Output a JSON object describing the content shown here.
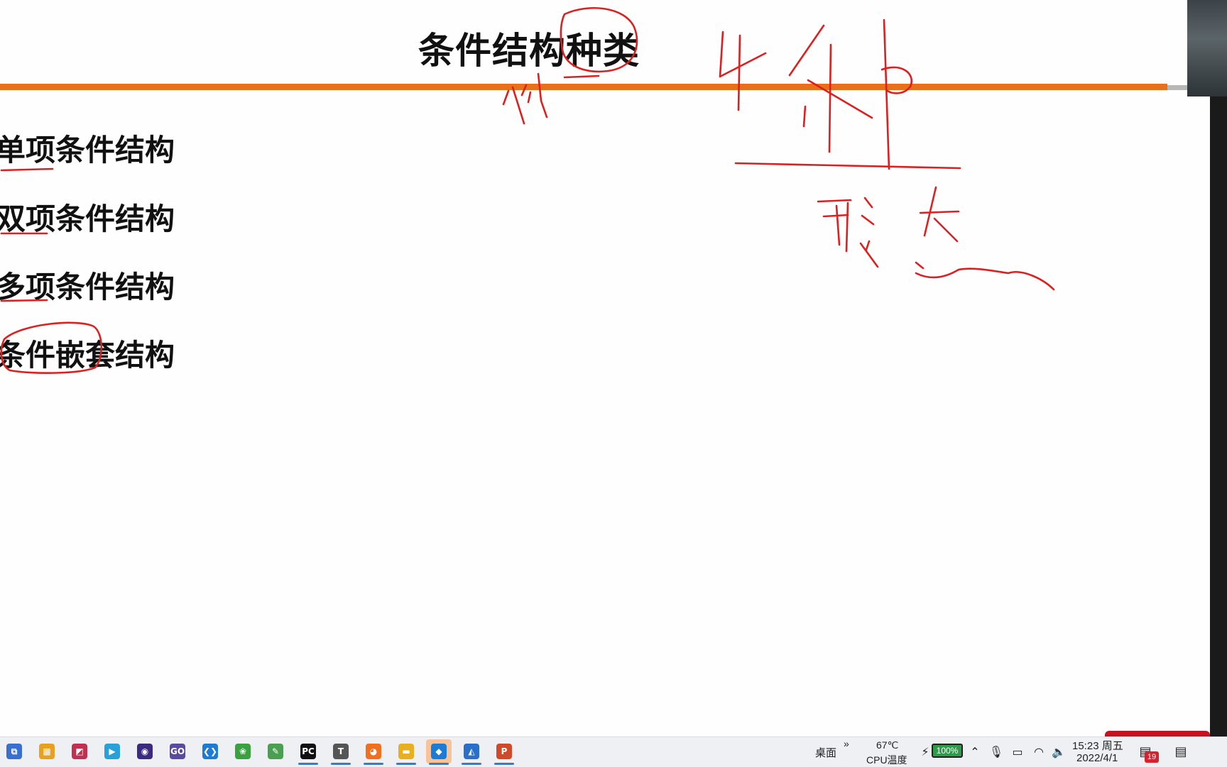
{
  "slide": {
    "title": "条件结构种类",
    "bullets": [
      {
        "label": "单项条件结构"
      },
      {
        "label": "双项条件结构"
      },
      {
        "label": "多项条件结构"
      },
      {
        "label": "条件嵌套结构"
      }
    ],
    "accent_color": "#e8701a",
    "annotation_color": "#dd1f1f"
  },
  "taskbar": {
    "apps": [
      {
        "name": "app-1-icon",
        "glyph": "⧉",
        "color": "#3a6fd0"
      },
      {
        "name": "app-2-icon",
        "glyph": "▦",
        "color": "#e8a020"
      },
      {
        "name": "app-3-icon",
        "glyph": "◩",
        "color": "#c03050"
      },
      {
        "name": "app-4-icon",
        "glyph": "▶",
        "color": "#2aa0d8"
      },
      {
        "name": "app-5-icon",
        "glyph": "◉",
        "color": "#3a2a80"
      },
      {
        "name": "app-6-icon",
        "glyph": "GO",
        "color": "#5a4aa0"
      },
      {
        "name": "vscode-icon",
        "glyph": "❮❯",
        "color": "#1e7bd4"
      },
      {
        "name": "app-8-icon",
        "glyph": "❀",
        "color": "#3aa040"
      },
      {
        "name": "app-9-icon",
        "glyph": "✎",
        "color": "#4aa050"
      },
      {
        "name": "pycharm-icon",
        "glyph": "PC",
        "color": "#111111"
      },
      {
        "name": "typora-icon",
        "glyph": "T",
        "color": "#555555"
      },
      {
        "name": "app-12-icon",
        "glyph": "◕",
        "color": "#f07020"
      },
      {
        "name": "file-explorer-icon",
        "glyph": "▬",
        "color": "#e8b020"
      },
      {
        "name": "app-14-icon",
        "glyph": "◆",
        "color": "#1e7bd4"
      },
      {
        "name": "app-15-icon",
        "glyph": "◭",
        "color": "#2a70c8"
      },
      {
        "name": "powerpoint-icon",
        "glyph": "P",
        "color": "#d04a2a"
      }
    ],
    "desktop_label": "桌面",
    "overflow_glyph": "»",
    "cpu_temp": "67℃",
    "cpu_label": "CPU温度",
    "battery": "100%",
    "time": "15:23 周五",
    "date": "2022/4/1",
    "notification_count": "19"
  }
}
